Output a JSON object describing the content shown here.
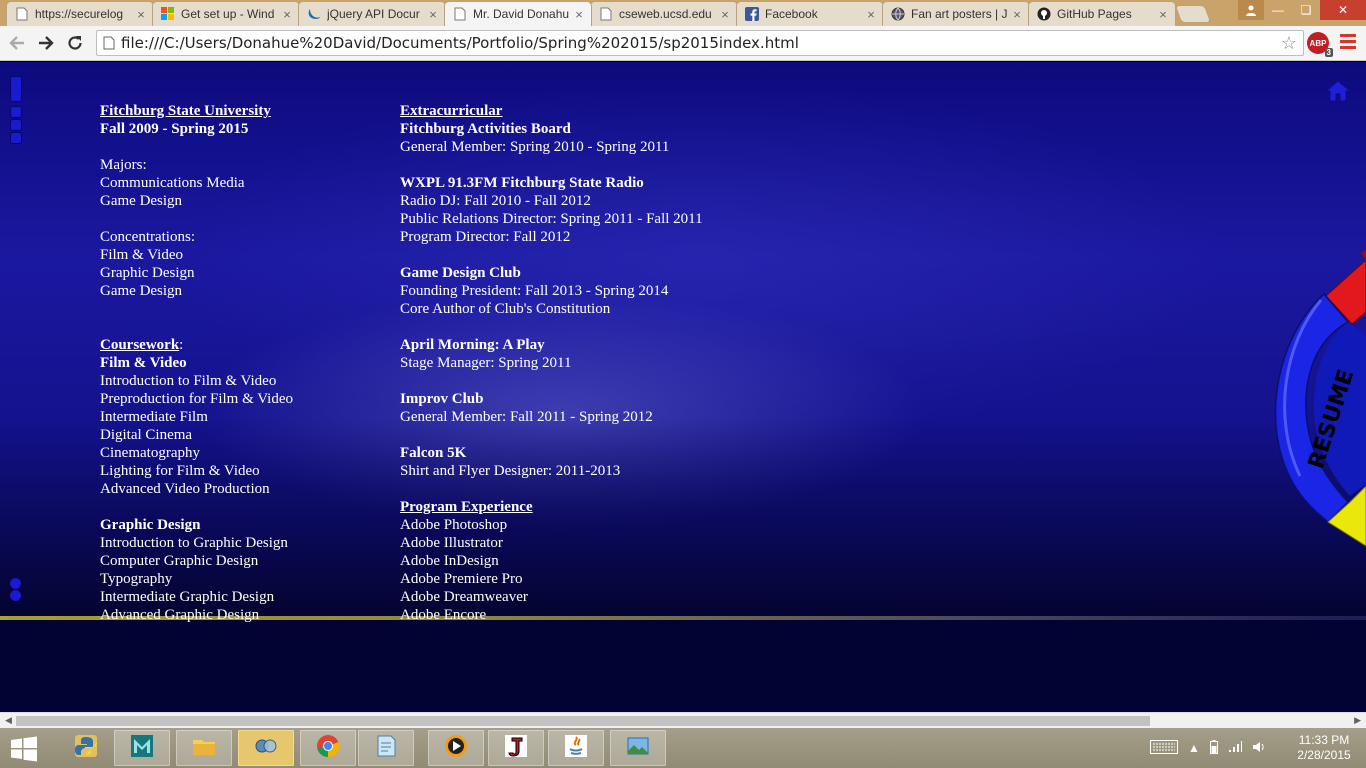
{
  "browser": {
    "tabs": [
      {
        "title": "https://securelog",
        "icon": "doc-icon"
      },
      {
        "title": "Get set up - Wind",
        "icon": "windows-icon"
      },
      {
        "title": "jQuery API Docur",
        "icon": "jquery-icon"
      },
      {
        "title": "Mr. David Donahu",
        "icon": "doc-icon",
        "active": true
      },
      {
        "title": "cseweb.ucsd.edu",
        "icon": "doc-icon"
      },
      {
        "title": "Facebook",
        "icon": "facebook-icon"
      },
      {
        "title": "Fan art posters | J",
        "icon": "globe-icon"
      },
      {
        "title": "GitHub Pages",
        "icon": "github-icon"
      }
    ],
    "url": "file:///C:/Users/Donahue%20David/Documents/Portfolio/Spring%202015/sp2015index.html",
    "abp_label": "ABP",
    "abp_count": "3"
  },
  "left_column": [
    {
      "text": "Fitchburg State University",
      "bold": true,
      "underline": true
    },
    {
      "text": "Fall 2009 - Spring 2015",
      "bold": true
    },
    {
      "gap": true
    },
    {
      "text": "Majors:"
    },
    {
      "text": "Communications Media"
    },
    {
      "text": "Game Design"
    },
    {
      "gap": true
    },
    {
      "text": "Concentrations:"
    },
    {
      "text": "Film & Video"
    },
    {
      "text": "Graphic Design"
    },
    {
      "text": "Game Design"
    },
    {
      "gap": true
    },
    {
      "gap": true
    },
    {
      "text": "Coursework",
      "bold": true,
      "underline": true,
      "suffix": ":"
    },
    {
      "text": "Film & Video",
      "bold": true
    },
    {
      "text": "Introduction to Film & Video"
    },
    {
      "text": "Preproduction for Film & Video"
    },
    {
      "text": "Intermediate Film"
    },
    {
      "text": "Digital Cinema"
    },
    {
      "text": "Cinematography"
    },
    {
      "text": "Lighting for Film & Video"
    },
    {
      "text": "Advanced Video Production"
    },
    {
      "gap": true
    },
    {
      "text": "Graphic Design",
      "bold": true
    },
    {
      "text": "Introduction to Graphic Design"
    },
    {
      "text": "Computer Graphic Design"
    },
    {
      "text": "Typography"
    },
    {
      "text": "Intermediate Graphic Design"
    },
    {
      "text": "Advanced Graphic Design"
    }
  ],
  "right_column": [
    {
      "text": "Extracurricular",
      "bold": true,
      "underline": true
    },
    {
      "text": "Fitchburg Activities Board",
      "bold": true
    },
    {
      "text": "General Member: Spring 2010 - Spring 2011"
    },
    {
      "gap": true
    },
    {
      "text": "WXPL 91.3FM Fitchburg State Radio",
      "bold": true
    },
    {
      "text": "Radio DJ: Fall 2010 - Fall 2012"
    },
    {
      "text": "Public Relations Director: Spring 2011 - Fall 2011"
    },
    {
      "text": "Program Director: Fall 2012"
    },
    {
      "gap": true
    },
    {
      "text": "Game Design Club",
      "bold": true
    },
    {
      "text": "Founding President: Fall 2013 - Spring 2014"
    },
    {
      "text": "Core Author of Club's Constitution"
    },
    {
      "gap": true
    },
    {
      "text": "April Morning: A Play",
      "bold": true
    },
    {
      "text": "Stage Manager: Spring 2011"
    },
    {
      "gap": true
    },
    {
      "text": "Improv Club",
      "bold": true
    },
    {
      "text": "General Member: Fall 2011 - Spring 2012"
    },
    {
      "gap": true
    },
    {
      "text": "Falcon 5K",
      "bold": true
    },
    {
      "text": "Shirt and Flyer Designer: 2011-2013"
    },
    {
      "gap": true
    },
    {
      "text": "Program Experience",
      "bold": true,
      "underline": true
    },
    {
      "text": "Adobe Photoshop"
    },
    {
      "text": "Adobe Illustrator"
    },
    {
      "text": "Adobe InDesign"
    },
    {
      "text": "Adobe Premiere Pro"
    },
    {
      "text": "Adobe Dreamweaver"
    },
    {
      "text": "Adobe Encore"
    }
  ],
  "resume_wheel_label": "RESUME",
  "taskbar": {
    "apps": [
      "python-icon",
      "maya-icon",
      "file-explorer-icon",
      "network-app-icon",
      "chrome-icon",
      "notepad-icon",
      "media-player-icon",
      "j-app-icon",
      "java-icon",
      "photos-icon"
    ],
    "time": "11:33 PM",
    "date": "2/28/2015"
  },
  "colors": {
    "page_bg": "#01012d",
    "hero_blue": "#1b18a0",
    "text": "#ffffff",
    "accent_gold": "#a9a02e"
  }
}
